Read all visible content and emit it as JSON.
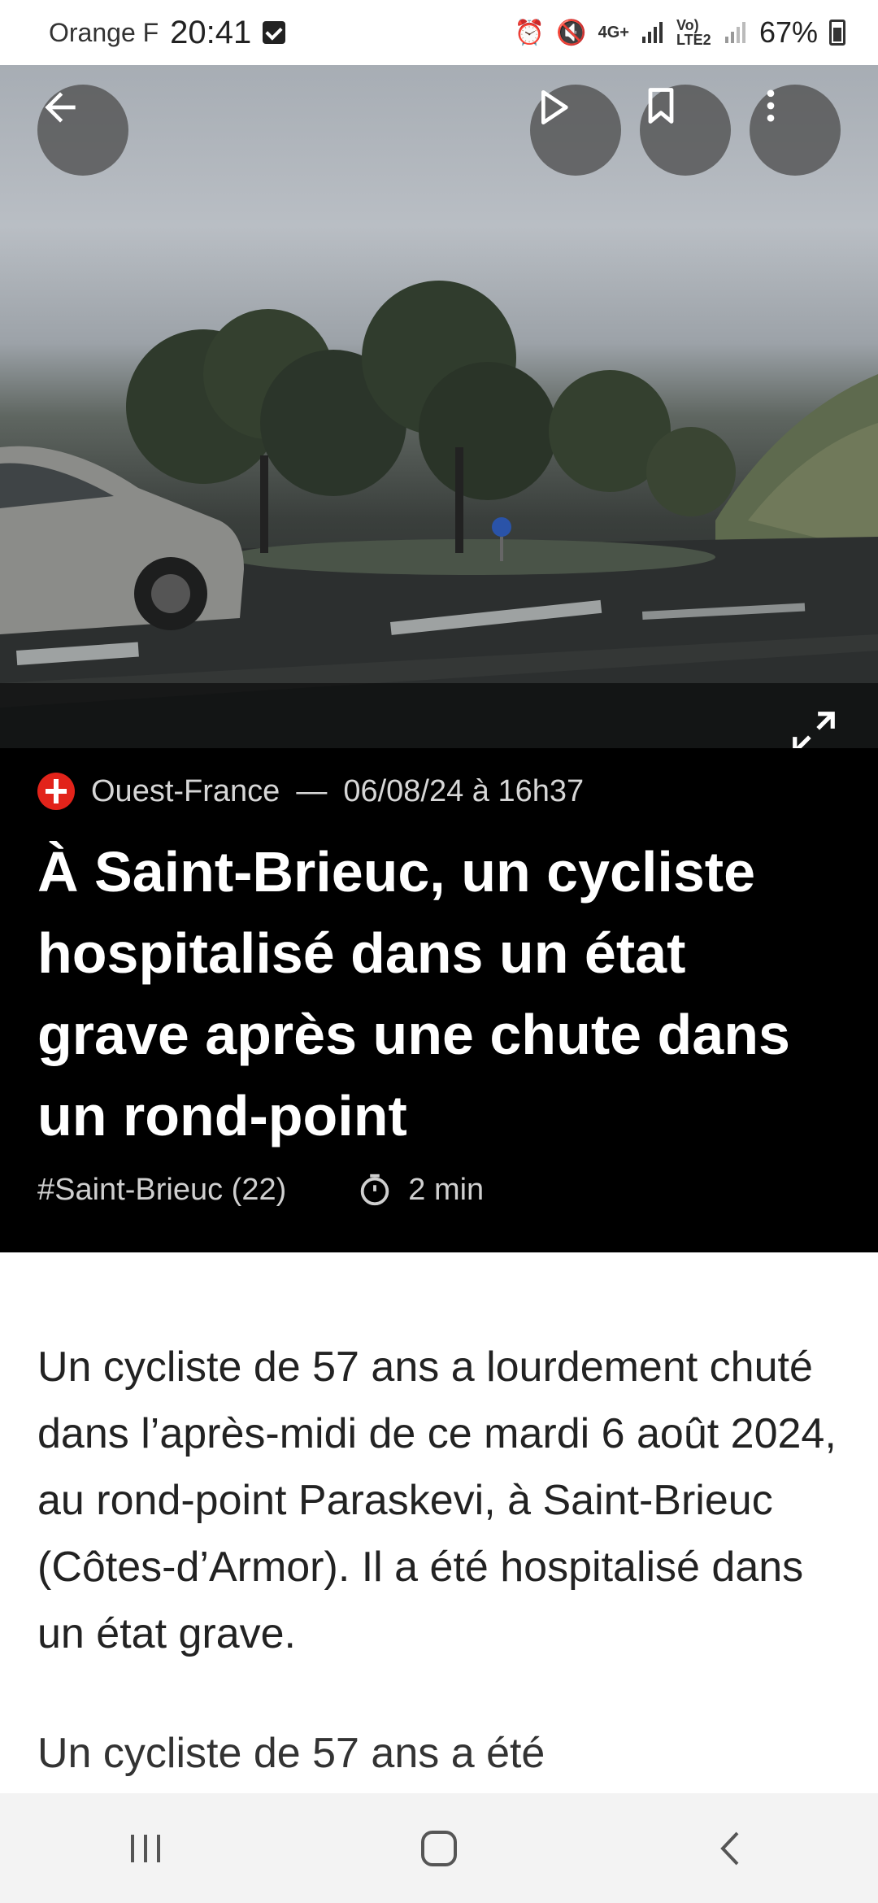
{
  "status_bar": {
    "carrier": "Orange F",
    "time": "20:41",
    "network": "4G+",
    "volte": "Vo) LTE2",
    "battery": "67%",
    "icons": [
      "checkbox-notification-icon",
      "alarm-icon",
      "mute-icon",
      "signal-icon",
      "battery-icon"
    ]
  },
  "toolbar": {
    "back_icon": "arrow-left-icon",
    "play_icon": "play-icon",
    "bookmark_icon": "bookmark-icon",
    "more_icon": "more-vertical-icon",
    "expand_icon": "expand-icon"
  },
  "article": {
    "source": "Ouest-France",
    "separator": "—",
    "date": "06/08/24 à 16h37",
    "title": "À Saint-Brieuc, un cycliste hospitalisé dans un état grave après une chute dans un rond-point",
    "tag": "#Saint-Brieuc (22)",
    "read_time": "2 min",
    "lead": "Un cycliste de 57 ans a lourdement chuté dans l’après-midi de ce mardi 6 août 2024, au rond-point Paraskevi, à Saint-Brieuc (Côtes-d’Armor). Il a été hospitalisé dans un état grave.",
    "paragraph_start": "Un cycliste de 57 ans a été"
  },
  "colors": {
    "header_bg": "#000000",
    "body_bg": "#ffffff",
    "source_logo": "#e2231a",
    "navbar_bg": "#f3f3f3"
  }
}
